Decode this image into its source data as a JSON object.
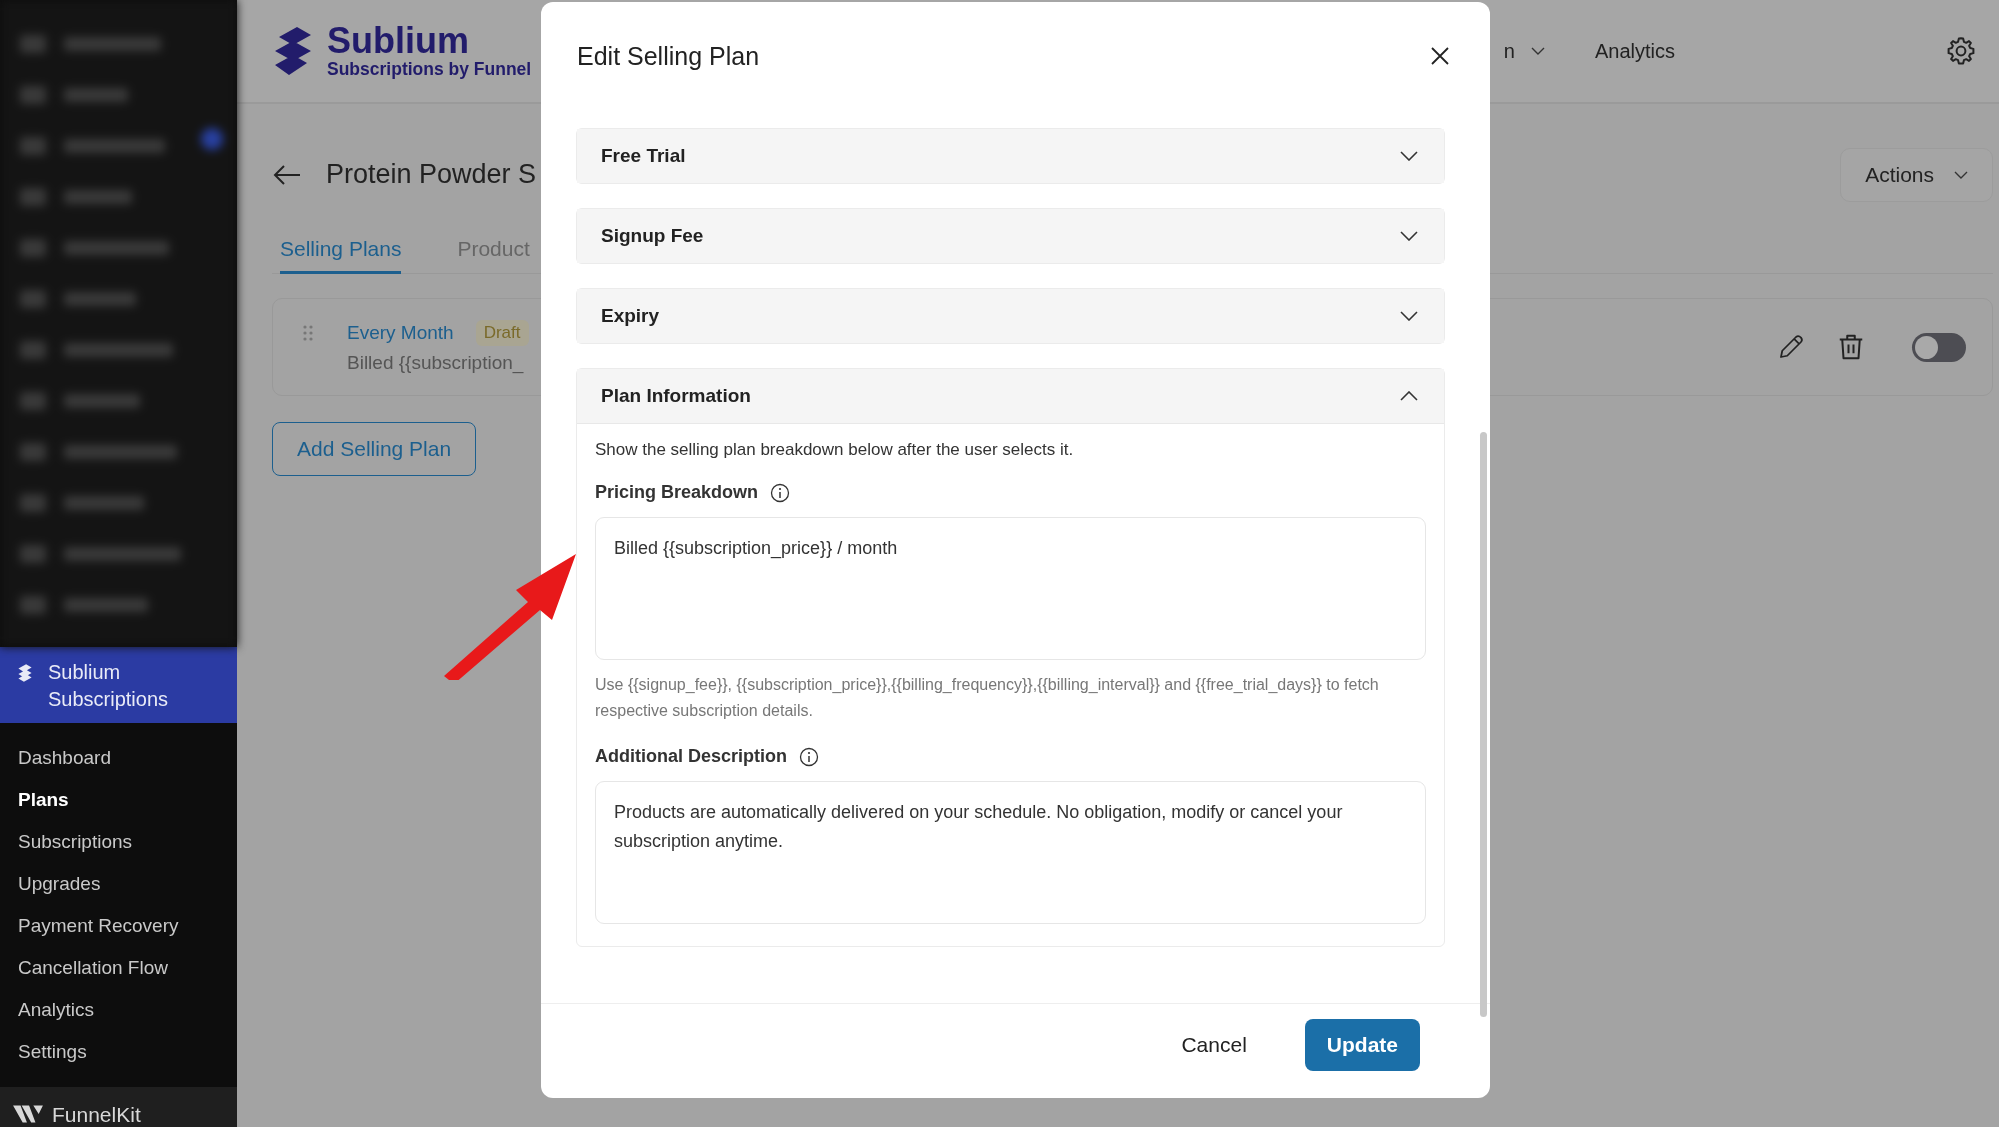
{
  "sidebar": {
    "menu": {
      "label": "Sublium Subscriptions",
      "selected": true
    },
    "items": [
      {
        "label": "Dashboard",
        "selected": false
      },
      {
        "label": "Plans",
        "selected": true
      },
      {
        "label": "Subscriptions",
        "selected": false
      },
      {
        "label": "Upgrades",
        "selected": false
      },
      {
        "label": "Payment Recovery",
        "selected": false
      },
      {
        "label": "Cancellation Flow",
        "selected": false
      },
      {
        "label": "Analytics",
        "selected": false
      },
      {
        "label": "Settings",
        "selected": false
      }
    ],
    "footer": "FunnelKit"
  },
  "header": {
    "logo_title": "Sublium",
    "logo_subtitle": "Subscriptions by Funnel",
    "nav": [
      {
        "label": "n",
        "dropdown": true
      },
      {
        "label": "Analytics",
        "dropdown": false
      }
    ]
  },
  "page": {
    "title": "Protein Powder S",
    "actions": "Actions",
    "tabs": [
      {
        "label": "Selling Plans",
        "selected": true
      },
      {
        "label": "Product",
        "selected": false
      }
    ],
    "plans": [
      {
        "name": "Every Month",
        "status": "Draft",
        "description": "Billed {{subscription_",
        "enabled": false
      }
    ],
    "add_button": "Add Selling Plan"
  },
  "modal": {
    "title": "Edit Selling Plan",
    "sections": [
      {
        "title": "Free Trial",
        "expanded": false
      },
      {
        "title": "Signup Fee",
        "expanded": false
      },
      {
        "title": "Expiry",
        "expanded": false
      },
      {
        "title": "Plan Information",
        "expanded": true
      }
    ],
    "plan_info": {
      "intro": "Show the selling plan breakdown below after the user selects it.",
      "fields": [
        {
          "label": "Pricing Breakdown",
          "value": "Billed {{subscription_price}} / month",
          "help": "Use {{signup_fee}}, {{subscription_price}},{{billing_frequency}},{{billing_interval}} and {{free_trial_days}} to fetch respective subscription details."
        },
        {
          "label": "Additional Description",
          "value": "Products are automatically delivered on your schedule. No obligation, modify or cancel your subscription anytime."
        }
      ]
    },
    "buttons": [
      {
        "label": "Cancel",
        "kind": "secondary"
      },
      {
        "label": "Update",
        "kind": "primary"
      }
    ]
  }
}
